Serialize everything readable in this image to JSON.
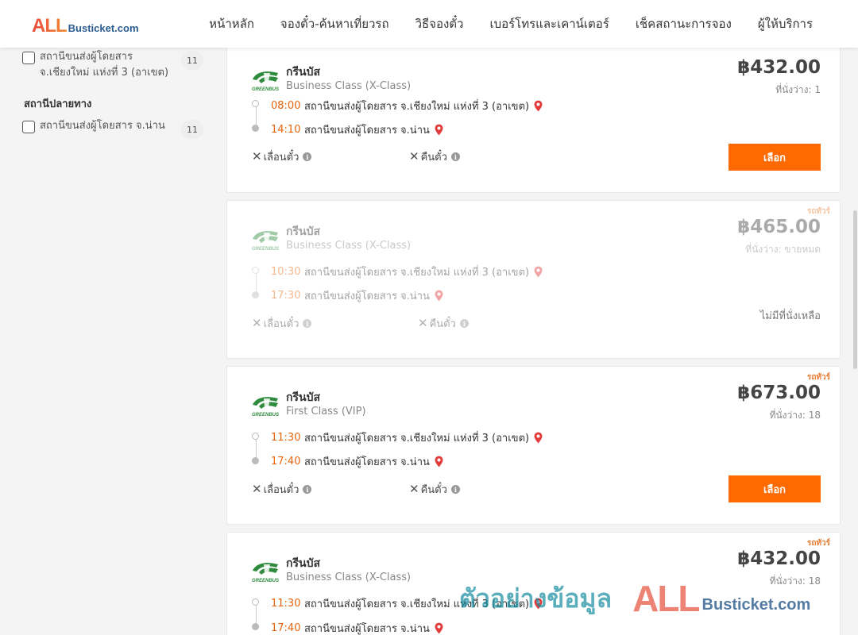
{
  "brand": {
    "logo_all": "ALL",
    "logo_rest": "Busticket.com"
  },
  "nav": [
    "หน้าหลัก",
    "จองตั๋ว-ค้นหาเที่ยวรถ",
    "วิธีจองตั๋ว",
    "เบอร์โทรและเคาน์เตอร์",
    "เช็คสถานะการจอง",
    "ผู้ให้บริการ"
  ],
  "sidebar": {
    "origin_filter": {
      "label": "สถานีขนส่งผู้โดยสาร จ.เชียงใหม่ แห่งที่ 3 (อาเขต)",
      "count": "11"
    },
    "destination_heading": "สถานีปลายทาง",
    "destination_filter": {
      "label": "สถานีขนส่งผู้โดยสาร จ.น่าน",
      "count": "11"
    }
  },
  "labels": {
    "reschedule": "เลื่อนตั๋ว",
    "refund": "คืนตั๋ว",
    "select": "เลือก",
    "no_seat": "ไม่มีที่นั่งเหลือ",
    "vip_tag": "รถทัวร์"
  },
  "trips": [
    {
      "operator": "กรีนบัส",
      "class": "Business Class (X-Class)",
      "price": "฿432.00",
      "seats": "ที่นั่งว่าง: 1",
      "depart_time": "08:00",
      "depart_station": "สถานีขนส่งผู้โดยสาร จ.เชียงใหม่ แห่งที่ 3 (อาเขต)",
      "arrive_time": "14:10",
      "arrive_station": "สถานีขนส่งผู้โดยสาร จ.น่าน",
      "sold_out": false
    },
    {
      "operator": "กรีนบัส",
      "class": "Business Class (X-Class)",
      "price": "฿465.00",
      "seats": "ที่นั่งว่าง: ขายหมด",
      "depart_time": "10:30",
      "depart_station": "สถานีขนส่งผู้โดยสาร จ.เชียงใหม่ แห่งที่ 3 (อาเขต)",
      "arrive_time": "17:30",
      "arrive_station": "สถานีขนส่งผู้โดยสาร จ.น่าน",
      "sold_out": true
    },
    {
      "operator": "กรีนบัส",
      "class": "First Class (VIP)",
      "price": "฿673.00",
      "seats": "ที่นั่งว่าง: 18",
      "depart_time": "11:30",
      "depart_station": "สถานีขนส่งผู้โดยสาร จ.เชียงใหม่ แห่งที่ 3 (อาเขต)",
      "arrive_time": "17:40",
      "arrive_station": "สถานีขนส่งผู้โดยสาร จ.น่าน",
      "sold_out": false
    },
    {
      "operator": "กรีนบัส",
      "class": "Business Class (X-Class)",
      "price": "฿432.00",
      "seats": "ที่นั่งว่าง: 18",
      "depart_time": "11:30",
      "depart_station": "สถานีขนส่งผู้โดยสาร จ.เชียงใหม่ แห่งที่ 3 (อาเขต)",
      "arrive_time": "17:40",
      "arrive_station": "สถานีขนส่งผู้โดยสาร จ.น่าน",
      "sold_out": false
    }
  ],
  "watermark": {
    "text": "ตัวอย่างข้อมูล",
    "all": "ALL",
    "rest": "Busticket.com"
  },
  "colors": {
    "accent": "#ff6a00",
    "time": "#e8640c",
    "pin": "#e23b3b",
    "greenbus": "#2e8b3e"
  }
}
